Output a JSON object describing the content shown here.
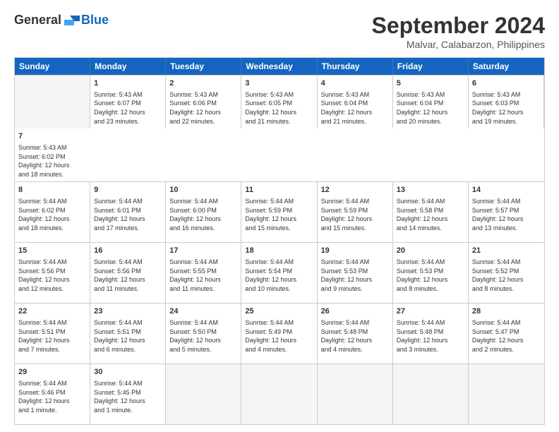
{
  "logo": {
    "general": "General",
    "blue": "Blue"
  },
  "title": "September 2024",
  "location": "Malvar, Calabarzon, Philippines",
  "header_days": [
    "Sunday",
    "Monday",
    "Tuesday",
    "Wednesday",
    "Thursday",
    "Friday",
    "Saturday"
  ],
  "rows": [
    [
      {
        "day": "",
        "empty": true
      },
      {
        "day": "1",
        "info": "Sunrise: 5:43 AM\nSunset: 6:07 PM\nDaylight: 12 hours\nand 23 minutes."
      },
      {
        "day": "2",
        "info": "Sunrise: 5:43 AM\nSunset: 6:06 PM\nDaylight: 12 hours\nand 22 minutes."
      },
      {
        "day": "3",
        "info": "Sunrise: 5:43 AM\nSunset: 6:05 PM\nDaylight: 12 hours\nand 21 minutes."
      },
      {
        "day": "4",
        "info": "Sunrise: 5:43 AM\nSunset: 6:04 PM\nDaylight: 12 hours\nand 21 minutes."
      },
      {
        "day": "5",
        "info": "Sunrise: 5:43 AM\nSunset: 6:04 PM\nDaylight: 12 hours\nand 20 minutes."
      },
      {
        "day": "6",
        "info": "Sunrise: 5:43 AM\nSunset: 6:03 PM\nDaylight: 12 hours\nand 19 minutes."
      },
      {
        "day": "7",
        "info": "Sunrise: 5:43 AM\nSunset: 6:02 PM\nDaylight: 12 hours\nand 18 minutes."
      }
    ],
    [
      {
        "day": "8",
        "info": "Sunrise: 5:44 AM\nSunset: 6:02 PM\nDaylight: 12 hours\nand 18 minutes."
      },
      {
        "day": "9",
        "info": "Sunrise: 5:44 AM\nSunset: 6:01 PM\nDaylight: 12 hours\nand 17 minutes."
      },
      {
        "day": "10",
        "info": "Sunrise: 5:44 AM\nSunset: 6:00 PM\nDaylight: 12 hours\nand 16 minutes."
      },
      {
        "day": "11",
        "info": "Sunrise: 5:44 AM\nSunset: 5:59 PM\nDaylight: 12 hours\nand 15 minutes."
      },
      {
        "day": "12",
        "info": "Sunrise: 5:44 AM\nSunset: 5:59 PM\nDaylight: 12 hours\nand 15 minutes."
      },
      {
        "day": "13",
        "info": "Sunrise: 5:44 AM\nSunset: 5:58 PM\nDaylight: 12 hours\nand 14 minutes."
      },
      {
        "day": "14",
        "info": "Sunrise: 5:44 AM\nSunset: 5:57 PM\nDaylight: 12 hours\nand 13 minutes."
      }
    ],
    [
      {
        "day": "15",
        "info": "Sunrise: 5:44 AM\nSunset: 5:56 PM\nDaylight: 12 hours\nand 12 minutes."
      },
      {
        "day": "16",
        "info": "Sunrise: 5:44 AM\nSunset: 5:56 PM\nDaylight: 12 hours\nand 11 minutes."
      },
      {
        "day": "17",
        "info": "Sunrise: 5:44 AM\nSunset: 5:55 PM\nDaylight: 12 hours\nand 11 minutes."
      },
      {
        "day": "18",
        "info": "Sunrise: 5:44 AM\nSunset: 5:54 PM\nDaylight: 12 hours\nand 10 minutes."
      },
      {
        "day": "19",
        "info": "Sunrise: 5:44 AM\nSunset: 5:53 PM\nDaylight: 12 hours\nand 9 minutes."
      },
      {
        "day": "20",
        "info": "Sunrise: 5:44 AM\nSunset: 5:53 PM\nDaylight: 12 hours\nand 8 minutes."
      },
      {
        "day": "21",
        "info": "Sunrise: 5:44 AM\nSunset: 5:52 PM\nDaylight: 12 hours\nand 8 minutes."
      }
    ],
    [
      {
        "day": "22",
        "info": "Sunrise: 5:44 AM\nSunset: 5:51 PM\nDaylight: 12 hours\nand 7 minutes."
      },
      {
        "day": "23",
        "info": "Sunrise: 5:44 AM\nSunset: 5:51 PM\nDaylight: 12 hours\nand 6 minutes."
      },
      {
        "day": "24",
        "info": "Sunrise: 5:44 AM\nSunset: 5:50 PM\nDaylight: 12 hours\nand 5 minutes."
      },
      {
        "day": "25",
        "info": "Sunrise: 5:44 AM\nSunset: 5:49 PM\nDaylight: 12 hours\nand 4 minutes."
      },
      {
        "day": "26",
        "info": "Sunrise: 5:44 AM\nSunset: 5:48 PM\nDaylight: 12 hours\nand 4 minutes."
      },
      {
        "day": "27",
        "info": "Sunrise: 5:44 AM\nSunset: 5:48 PM\nDaylight: 12 hours\nand 3 minutes."
      },
      {
        "day": "28",
        "info": "Sunrise: 5:44 AM\nSunset: 5:47 PM\nDaylight: 12 hours\nand 2 minutes."
      }
    ],
    [
      {
        "day": "29",
        "info": "Sunrise: 5:44 AM\nSunset: 5:46 PM\nDaylight: 12 hours\nand 1 minute."
      },
      {
        "day": "30",
        "info": "Sunrise: 5:44 AM\nSunset: 5:45 PM\nDaylight: 12 hours\nand 1 minute."
      },
      {
        "day": "",
        "empty": true
      },
      {
        "day": "",
        "empty": true
      },
      {
        "day": "",
        "empty": true
      },
      {
        "day": "",
        "empty": true
      },
      {
        "day": "",
        "empty": true
      }
    ]
  ]
}
